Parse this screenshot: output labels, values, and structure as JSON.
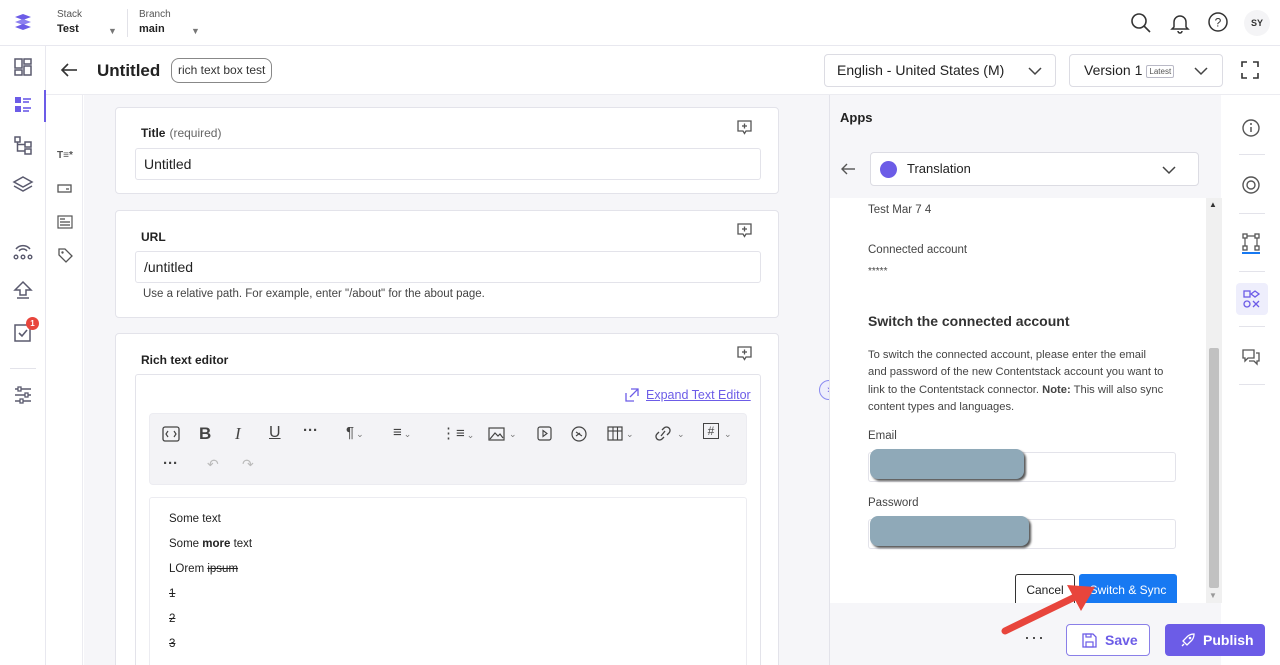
{
  "topbar": {
    "stack": {
      "label": "Stack",
      "value": "Test"
    },
    "branch": {
      "label": "Branch",
      "value": "main"
    },
    "avatar_initials": "SY"
  },
  "left_rail": {
    "notification_count": "1",
    "icons": [
      "dashboard-icon",
      "entries-icon",
      "content-models-icon",
      "assets-icon",
      "releases-icon",
      "deploy-icon",
      "workflow-tasks-icon",
      "settings-sliders-icon"
    ]
  },
  "header": {
    "title": "Untitled",
    "tag": "rich text box test",
    "locale": "English - United States (M)",
    "version": "Version 1",
    "version_badge": "Latest"
  },
  "field_icons": [
    "text-field-icon",
    "url-field-icon",
    "rte-field-icon",
    "tag-icon"
  ],
  "fields": {
    "title": {
      "label": "Title",
      "required_note": "(required)",
      "value": "Untitled"
    },
    "url": {
      "label": "URL",
      "value": "/untitled",
      "help": "Use a relative path. For example, enter \"/about\" for the about page."
    },
    "rte": {
      "label": "Rich text editor",
      "expand_link": "Expand Text Editor",
      "lines": {
        "l1": "Some text",
        "l2_pre": "Some ",
        "l2_bold": "more",
        "l2_post": " text",
        "l3_pre": "LOrem ",
        "l3_strike": "ipsum ",
        "l4": "1",
        "l5": "2",
        "l6": "3"
      }
    }
  },
  "apps_panel": {
    "title": "Apps",
    "selected_app": "Translation",
    "entry_name": "Test Mar 7 4",
    "connected_account_label": "Connected account",
    "connected_account_value": "*****",
    "switch_heading": "Switch the connected account",
    "para_main": "To switch the connected account, please enter the email and password of the new Contentstack account you want to link to the Contentstack connector. ",
    "para_note_bold": "Note:",
    "para_note": " This will also sync content types and languages.",
    "email_label": "Email",
    "password_label": "Password",
    "cancel_label": "Cancel",
    "switch_sync_label": "Switch & Sync"
  },
  "right_rail": {
    "icons": [
      "info-icon",
      "target-icon",
      "workflow-icon",
      "apps-icon",
      "comments-icon"
    ]
  },
  "actions": {
    "more": "···",
    "save_label": "Save",
    "publish_label": "Publish"
  },
  "colors": {
    "accent": "#6c5ce7",
    "sync_button": "#1779f2",
    "badge": "#e8453c",
    "annotation_arrow": "#e8453c"
  }
}
